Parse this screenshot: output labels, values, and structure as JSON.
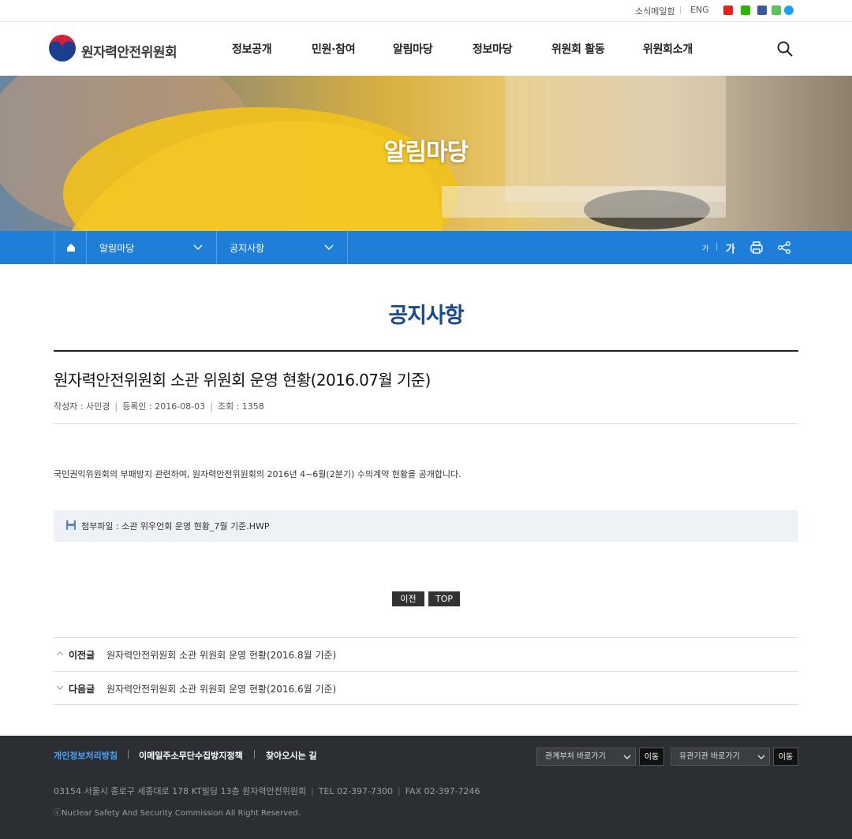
{
  "utility": {
    "newsletter": "소식메일함",
    "english": "ENG",
    "sns": [
      "youtube-icon",
      "blog-icon",
      "facebook-icon",
      "kakao-icon",
      "twitter-icon"
    ]
  },
  "header": {
    "logo_text": "원자력안전위원회",
    "gnb": [
      "정보공개",
      "민원·참여",
      "알림마당",
      "정보마당",
      "위원회 활동",
      "위원회소개"
    ]
  },
  "hero": {
    "title": "알림마당"
  },
  "location": {
    "depth1": "알림마당",
    "depth2": "공지사항",
    "font_small": "가",
    "font_large": "가"
  },
  "page": {
    "title": "공지사항"
  },
  "post": {
    "title": "원자력안전위원회 소관 위원회 운영 현황(2016.07월 기준)",
    "author": "작성자 : 사민경",
    "date": "등록인 : 2016-08-03",
    "views": "조회 : 1358",
    "body": "국민권익위원회의 부패방지 관련하여, 원자력안전위원회의 2016년 4~6월(2분기) 수의계약 현황을 공개합니다.",
    "attachment": "첨부파일 : 소관 위우언회 운영 현황_7월 기준.HWP"
  },
  "buttons": {
    "prev": "이전",
    "top": "TOP"
  },
  "nav": {
    "prev_label": "이전글",
    "prev_title": "원자력안전위원회 소관 위원회 운영 현황(2016.8월 기준)",
    "next_label": "다음글",
    "next_title": "원자력안전위원회 소관 위원회 운영 현황(2016.6월 기준)"
  },
  "footer": {
    "privacy": "개인정보처리방침",
    "email_policy": "이메일주소무단수집방지정책",
    "directions": "찾아오시는 길",
    "select1": "관계부처 바로가기",
    "select2": "유관기관 바로가기",
    "go": "이동",
    "address": "03154 서울시 종로구 세종대로 178 KT빌딩 13층 원자력안전위원회",
    "tel": "TEL 02-397-7300",
    "fax": "FAX 02-397-7246",
    "copyright": "ⓒNuclear Safety And Security Commission All Right Reserved."
  },
  "colors": {
    "accent": "#1f7ed8",
    "title": "#1a4a8a",
    "privacy_link": "#4aa3ff"
  }
}
